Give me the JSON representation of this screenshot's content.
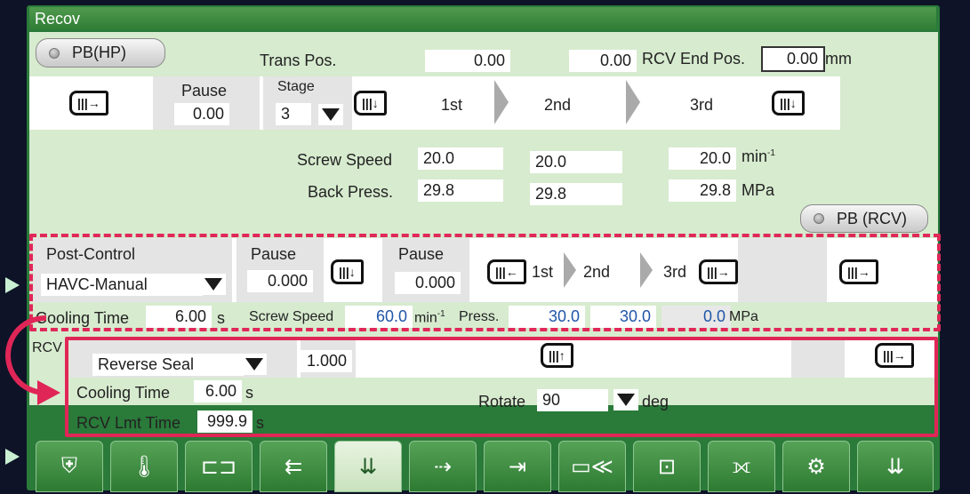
{
  "window": {
    "title": "Recov"
  },
  "recovery": {
    "pb_hp_label": "PB(HP)",
    "trans_pos_label": "Trans Pos.",
    "trans_pos_value_1": "0.00",
    "trans_pos_value_2": "0.00",
    "rcv_end_pos_label": "RCV End Pos.",
    "rcv_end_pos_value": "0.00",
    "rcv_end_pos_unit": "mm",
    "pause_label": "Pause",
    "pause_value": "0.00",
    "stage_label": "Stage",
    "stage_value": "3",
    "step_labels": [
      "1st",
      "2nd",
      "3rd"
    ],
    "screw_speed_label": "Screw Speed",
    "screw_speed_values": [
      "20.0",
      "20.0",
      "20.0"
    ],
    "screw_speed_unit": "min",
    "screw_speed_unit_sup": "-1",
    "back_press_label": "Back Press.",
    "back_press_values": [
      "29.8",
      "29.8",
      "29.8"
    ],
    "back_press_unit": "MPa",
    "pb_rcv_label": "PB (RCV)"
  },
  "post_control": {
    "label": "Post-Control",
    "mode_value": "HAVC-Manual",
    "pause1_label": "Pause",
    "pause1_value": "0.000",
    "pause2_label": "Pause",
    "pause2_value": "0.000",
    "step_labels": [
      "1st",
      "2nd",
      "3rd"
    ],
    "cooling_time_label": "Cooling Time",
    "cooling_time_value": "6.00",
    "cooling_time_unit": "s",
    "screw_speed_label": "Screw Speed",
    "screw_speed_value": "60.0",
    "screw_speed_unit": "min",
    "screw_speed_unit_sup": "-1",
    "press_label": "Press.",
    "press_values": [
      "30.0",
      "30.0",
      "0.0"
    ],
    "press_unit": "MPa"
  },
  "rcv": {
    "label": "RCV",
    "mode_value": "Reverse Seal",
    "timer_value": "1.000",
    "cooling_time_label": "Cooling Time",
    "cooling_time_value": "6.00",
    "cooling_time_unit": "s",
    "rotate_label": "Rotate",
    "rotate_value": "90",
    "rotate_unit": "deg",
    "rcv_lmt_time_label": "RCV Lmt Time",
    "rcv_lmt_time_value": "999.9",
    "rcv_lmt_time_unit": "s"
  },
  "tabs": [
    {
      "icon": "mold-icon"
    },
    {
      "icon": "thermometer-icon"
    },
    {
      "icon": "mold-open-icon"
    },
    {
      "icon": "injection-icon"
    },
    {
      "icon": "recovery-icon",
      "active": true
    },
    {
      "icon": "ejector-icon"
    },
    {
      "icon": "core-icon"
    },
    {
      "icon": "nozzle-icon"
    },
    {
      "icon": "robot-icon"
    },
    {
      "icon": "valve-gate-icon"
    },
    {
      "icon": "settings-gear-icon"
    },
    {
      "icon": "screw-icon"
    }
  ],
  "colors": {
    "accent_dash": "#e0285a",
    "panel_bg": "#d7ebcf",
    "frame": "#2a7a3a",
    "value_blue": "#1f56a8"
  }
}
